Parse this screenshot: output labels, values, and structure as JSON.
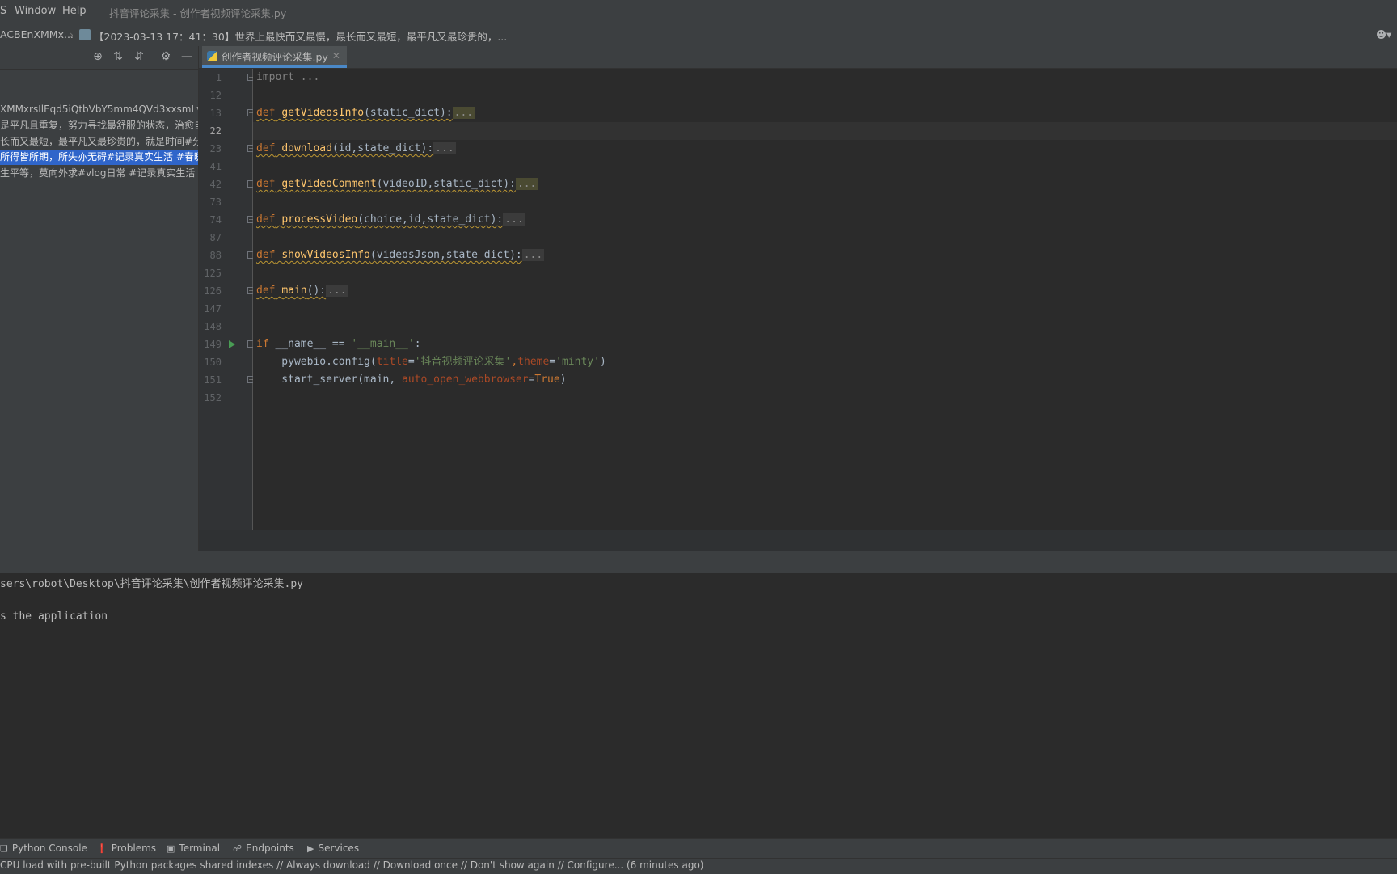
{
  "menu": {
    "items": [
      {
        "label": "S"
      },
      {
        "label": "Window"
      },
      {
        "label": "Help"
      }
    ],
    "window_title": "抖音评论采集 - 创作者视频评论采集.py"
  },
  "navbar": {
    "crumb_folder": "ACBEnXMMx...",
    "crumb_file": "【2023-03-13 17：41：30】世界上最快而又最慢，最长而又最短，最平凡又最珍贵的，..."
  },
  "project_panel": {
    "toolbar_icons": [
      "locate-icon",
      "expand-all-icon",
      "collapse-all-icon",
      "settings-icon",
      "minimize-icon"
    ],
    "rows": [
      "XMMxrsIlEqd5iQtbVbY5mm4QVd3xxsmLv",
      "是平凡且重复，努力寻找最舒服的状态，治愈自",
      "长而又最短，最平凡又最珍贵的，就是时间#分",
      "所得皆所期，所失亦无碍#记录真实生活 #春暖",
      "生平等，莫向外求#vlog日常 #记录真实生活 #"
    ]
  },
  "editor": {
    "tab_label": "创作者视频评论采集.py",
    "line_numbers": [
      "1",
      "12",
      "13",
      "22",
      "23",
      "41",
      "42",
      "73",
      "74",
      "87",
      "88",
      "125",
      "126",
      "147",
      "148",
      "149",
      "150",
      "151",
      "152"
    ],
    "code": {
      "l1": "import ...",
      "def": "def",
      "f1_name": "getVideosInfo",
      "f1_args": "(static_dict):",
      "f2_name": "download",
      "f2_args": "(id,state_dict):",
      "f3_name": "getVideoComment",
      "f3_args": "(videoID,static_dict):",
      "f4_name": "processVideo",
      "f4_args": "(choice,id,state_dict):",
      "f5_name": "showVideosInfo",
      "f5_args": "(videosJson,state_dict):",
      "f6_name": "main",
      "f6_args": "():",
      "ellipsis": "...",
      "if_kw": "if",
      "if_rest": " __name__ == ",
      "main_str": "'__main__'",
      "colon": ":",
      "cfg_call": "    pywebio.config(",
      "title_kw": "title",
      "eq": "=",
      "title_val": "'抖音视频评论采集'",
      "comma": ",",
      "theme_kw": "theme",
      "theme_val": "'minty'",
      "close_paren": ")",
      "srv_call": "    start_server(main, ",
      "auto_kw": "auto_open_webbrowser",
      "true_val": "True"
    }
  },
  "console": {
    "lines": [
      "sers\\robot\\Desktop\\抖音评论采集\\创作者视频评论采集.py",
      "",
      "s the application"
    ]
  },
  "tool_windows": [
    {
      "label": "Python Console",
      "icon": "python-console-icon"
    },
    {
      "label": "Problems",
      "icon": "problems-icon"
    },
    {
      "label": "Terminal",
      "icon": "terminal-icon"
    },
    {
      "label": "Endpoints",
      "icon": "endpoints-icon"
    },
    {
      "label": "Services",
      "icon": "services-icon"
    }
  ],
  "status": {
    "text": "CPU load with pre-built Python packages shared indexes // Always download // Download once // Don't show again // Configure... (6 minutes ago)"
  }
}
